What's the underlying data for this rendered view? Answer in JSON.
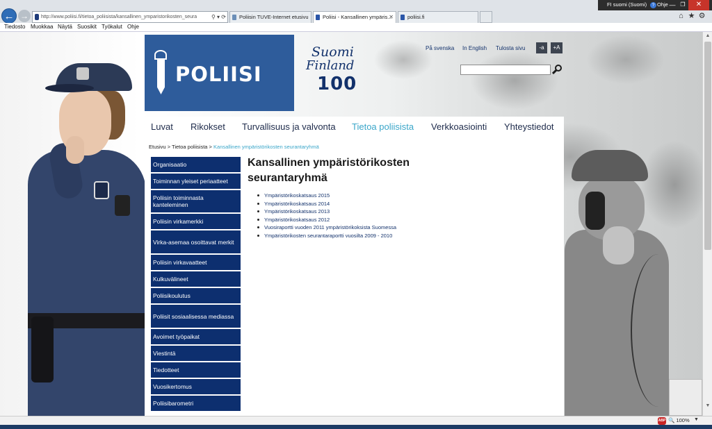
{
  "browser": {
    "address": "http://www.poliisi.fi/tietoa_poliisista/kansallinen_ymparistorikosten_seura",
    "tabs": [
      {
        "label": "Poliisin TUVE-Internet etusivu"
      },
      {
        "label": "Poliisi - Kansallinen ympäris..."
      },
      {
        "label": "poliisi.fi"
      }
    ],
    "language": "FI  suomi (Suomi)",
    "help": "Ohje",
    "menu": [
      "Tiedosto",
      "Muokkaa",
      "Näytä",
      "Suosikit",
      "Työkalut",
      "Ohje"
    ],
    "zoom": "100%"
  },
  "header": {
    "logo_text": "POLIISI",
    "finland_suomi": "Suomi",
    "finland_finland": "Finland",
    "finland_100": "100",
    "links": {
      "swedish": "På svenska",
      "english": "In English",
      "print": "Tulosta sivu"
    },
    "font_smaller": "-a",
    "font_larger": "+A",
    "search_value": ""
  },
  "nav": [
    {
      "label": "Luvat"
    },
    {
      "label": "Rikokset"
    },
    {
      "label": "Turvallisuus ja valvonta"
    },
    {
      "label": "Tietoa poliisista"
    },
    {
      "label": "Verkkoasiointi"
    },
    {
      "label": "Yhteystiedot"
    }
  ],
  "breadcrumb": {
    "home": "Etusivu",
    "sep": " > ",
    "parent": "Tietoa poliisista",
    "current": "Kansallinen ympäristörikosten seurantaryhmä"
  },
  "sidemenu": [
    {
      "label": "Organisaatio"
    },
    {
      "label": "Toiminnan yleiset periaatteet"
    },
    {
      "label": "Poliisin toiminnasta kanteleminen"
    },
    {
      "label": "Poliisin virkamerkki"
    },
    {
      "label": "Virka-asemaa osoittavat merkit"
    },
    {
      "label": "Poliisin virkavaatteet"
    },
    {
      "label": "Kulkuvälineet"
    },
    {
      "label": "Poliisikoulutus"
    },
    {
      "label": "Poliisit sosiaalisessa mediassa"
    },
    {
      "label": "Avoimet työpaikat"
    },
    {
      "label": "Viestintä"
    },
    {
      "label": "Tiedotteet"
    },
    {
      "label": "Vuosikertomus"
    },
    {
      "label": "Poliisibarometri"
    }
  ],
  "main": {
    "title": "Kansallinen ympäristörikosten seurantaryhmä",
    "documents": [
      {
        "label": "Ympäristörikoskatsaus 2015"
      },
      {
        "label": "Ympäristörikoskatsaus 2014"
      },
      {
        "label": "Ympäristörikoskatsaus 2013"
      },
      {
        "label": "Ympäristörikoskatsaus 2012"
      },
      {
        "label": "Vuosiraportti vuoden 2011 ympäristörikoksista Suomessa"
      },
      {
        "label": "Ympäristörikosten seurantaraportti vuosilta 2009 - 2010"
      }
    ]
  },
  "colors": {
    "brand_blue": "#2e5c9b",
    "menu_navy": "#0d2f6f",
    "active_nav": "#3aa6c9"
  }
}
